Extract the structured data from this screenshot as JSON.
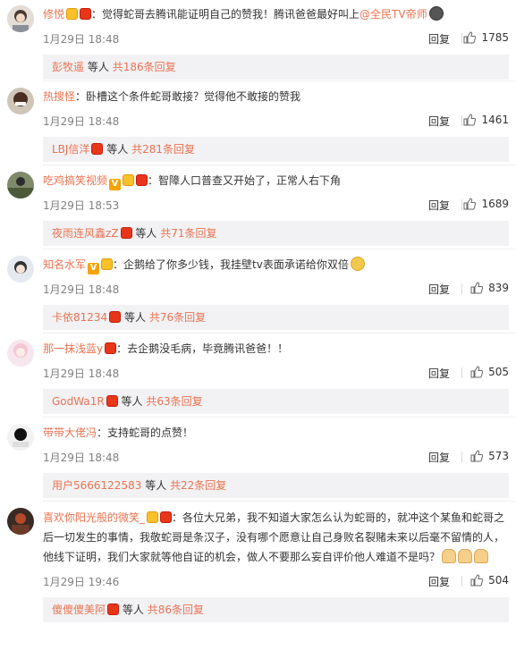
{
  "comments": [
    {
      "username": "修悦",
      "badges": [
        "vip",
        "red"
      ],
      "text_before": "：觉得蛇哥去腾讯能证明自己的赞我！腾讯爸爸最好叫上",
      "mention": "@全民TV帝师",
      "text_after": "",
      "trailing_emoji": "dark",
      "time": "1月29日 18:48",
      "reply_label": "回复",
      "likes": "1785",
      "sub": {
        "who": "彭牧遥",
        "middle": "等人",
        "count": "共186条回复",
        "red": false
      }
    },
    {
      "username": "热搜怪",
      "badges": [],
      "text_before": "：卧槽这个条件蛇哥敢接？觉得他不敢接的赞我",
      "mention": "",
      "text_after": "",
      "trailing_emoji": "",
      "time": "1月29日 18:48",
      "reply_label": "回复",
      "likes": "1461",
      "sub": {
        "who": "LBJ信洋",
        "middle": "等人",
        "count": "共281条回复",
        "red": true
      }
    },
    {
      "username": "吃鸡搞笑视频",
      "badges": [
        "v",
        "vip",
        "red"
      ],
      "text_before": "：智障人口普查又开始了，正常人右下角",
      "mention": "",
      "text_after": "",
      "trailing_emoji": "",
      "time": "1月29日 18:53",
      "reply_label": "回复",
      "likes": "1689",
      "sub": {
        "who": "夜雨连风鑫zZ",
        "middle": "等人",
        "count": "共71条回复",
        "red": true
      }
    },
    {
      "username": "知名水军",
      "badges": [
        "v",
        "vip"
      ],
      "text_before": "：企鹅给了你多少钱，我挂壁tv表面承诺给你双倍",
      "mention": "",
      "text_after": "",
      "trailing_emoji": "face",
      "time": "1月29日 18:48",
      "reply_label": "回复",
      "likes": "839",
      "sub": {
        "who": "卡依81234",
        "middle": "等人",
        "count": "共76条回复",
        "red": true
      }
    },
    {
      "username": "那一抹浅蓝y",
      "badges": [
        "red"
      ],
      "text_before": "：去企鹅没毛病，毕竟腾讯爸爸！！",
      "mention": "",
      "text_after": "",
      "trailing_emoji": "",
      "time": "1月29日 18:48",
      "reply_label": "回复",
      "likes": "505",
      "sub": {
        "who": "GodWa1R",
        "middle": "等人",
        "count": "共63条回复",
        "red": true
      }
    },
    {
      "username": "带带大佬冯",
      "badges": [],
      "text_before": "：支持蛇哥的点赞！",
      "mention": "",
      "text_after": "",
      "trailing_emoji": "",
      "time": "1月29日 18:48",
      "reply_label": "回复",
      "likes": "573",
      "sub": {
        "who": "用户5666122583",
        "middle": "等人",
        "count": "共22条回复",
        "red": false
      }
    },
    {
      "username": "喜欢你阳光般的微笑_",
      "badges": [
        "vip",
        "red"
      ],
      "text_before": "：各位大兄弟，我不知道大家怎么认为蛇哥的，就冲这个某鱼和蛇哥之后一切发生的事情，我敬蛇哥是条汉子，没有哪个愿意让自己身败名裂赌未来以后毫不留情的人，他线下证明，我们大家就等他自证的机会，做人不要那么妄自评价他人难道不是吗？",
      "mention": "",
      "text_after": "",
      "trailing_emoji": "hands",
      "time": "1月29日 19:46",
      "reply_label": "回复",
      "likes": "504",
      "sub": {
        "who": "傻傻傻美阿",
        "middle": "等人",
        "count": "共86条回复",
        "red": true
      }
    }
  ],
  "colors": {
    "link": "#eb7350",
    "reply_bg": "#f2f2f5",
    "muted": "#808080"
  }
}
